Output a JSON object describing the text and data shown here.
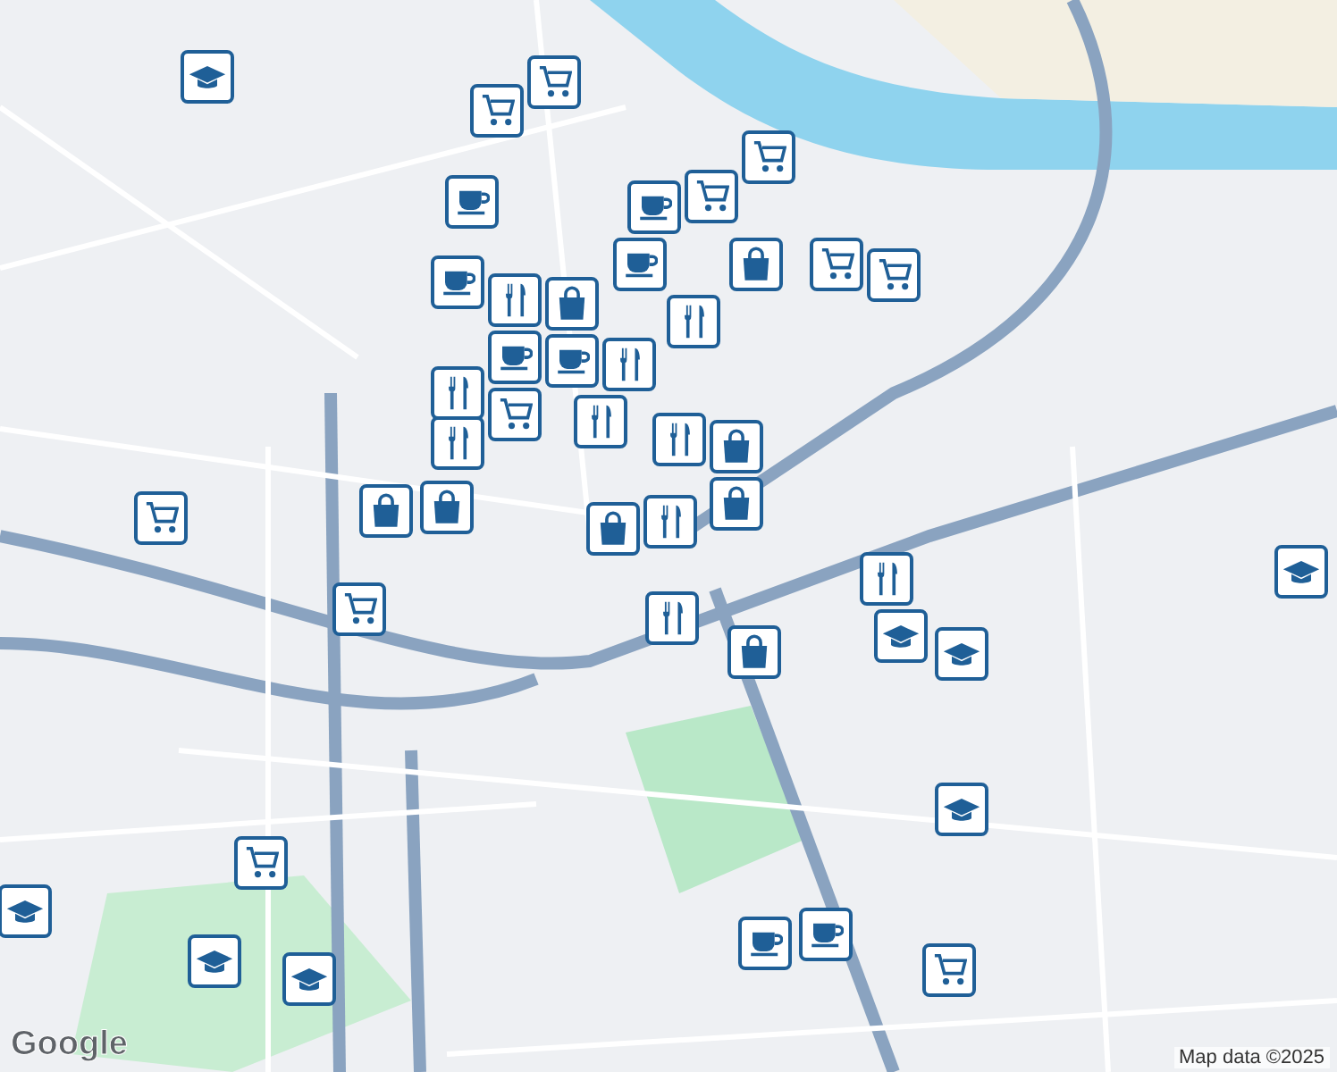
{
  "map": {
    "pins": [
      {
        "kind": "cap"
      },
      {
        "kind": "cart"
      },
      {
        "kind": "cart"
      },
      {
        "kind": "cup"
      },
      {
        "kind": "cart"
      },
      {
        "kind": "cart"
      },
      {
        "kind": "cup"
      },
      {
        "kind": "cup"
      },
      {
        "kind": "bag"
      },
      {
        "kind": "cart"
      },
      {
        "kind": "cart"
      },
      {
        "kind": "cup"
      },
      {
        "kind": "fork"
      },
      {
        "kind": "bag"
      },
      {
        "kind": "fork"
      },
      {
        "kind": "cup"
      },
      {
        "kind": "cup"
      },
      {
        "kind": "fork"
      },
      {
        "kind": "fork"
      },
      {
        "kind": "cart"
      },
      {
        "kind": "fork"
      },
      {
        "kind": "fork"
      },
      {
        "kind": "fork"
      },
      {
        "kind": "bag"
      },
      {
        "kind": "bag"
      },
      {
        "kind": "bag"
      },
      {
        "kind": "bag"
      },
      {
        "kind": "cart"
      },
      {
        "kind": "bag"
      },
      {
        "kind": "fork"
      },
      {
        "kind": "cart"
      },
      {
        "kind": "fork"
      },
      {
        "kind": "bag"
      },
      {
        "kind": "fork"
      },
      {
        "kind": "cap"
      },
      {
        "kind": "cap"
      },
      {
        "kind": "cap"
      },
      {
        "kind": "cap"
      },
      {
        "kind": "cart"
      },
      {
        "kind": "cap"
      },
      {
        "kind": "cap"
      },
      {
        "kind": "cap"
      },
      {
        "kind": "cup"
      },
      {
        "kind": "cup"
      },
      {
        "kind": "cart"
      }
    ]
  },
  "attribution": {
    "logo": "Google",
    "text": "Map data ©2025"
  }
}
